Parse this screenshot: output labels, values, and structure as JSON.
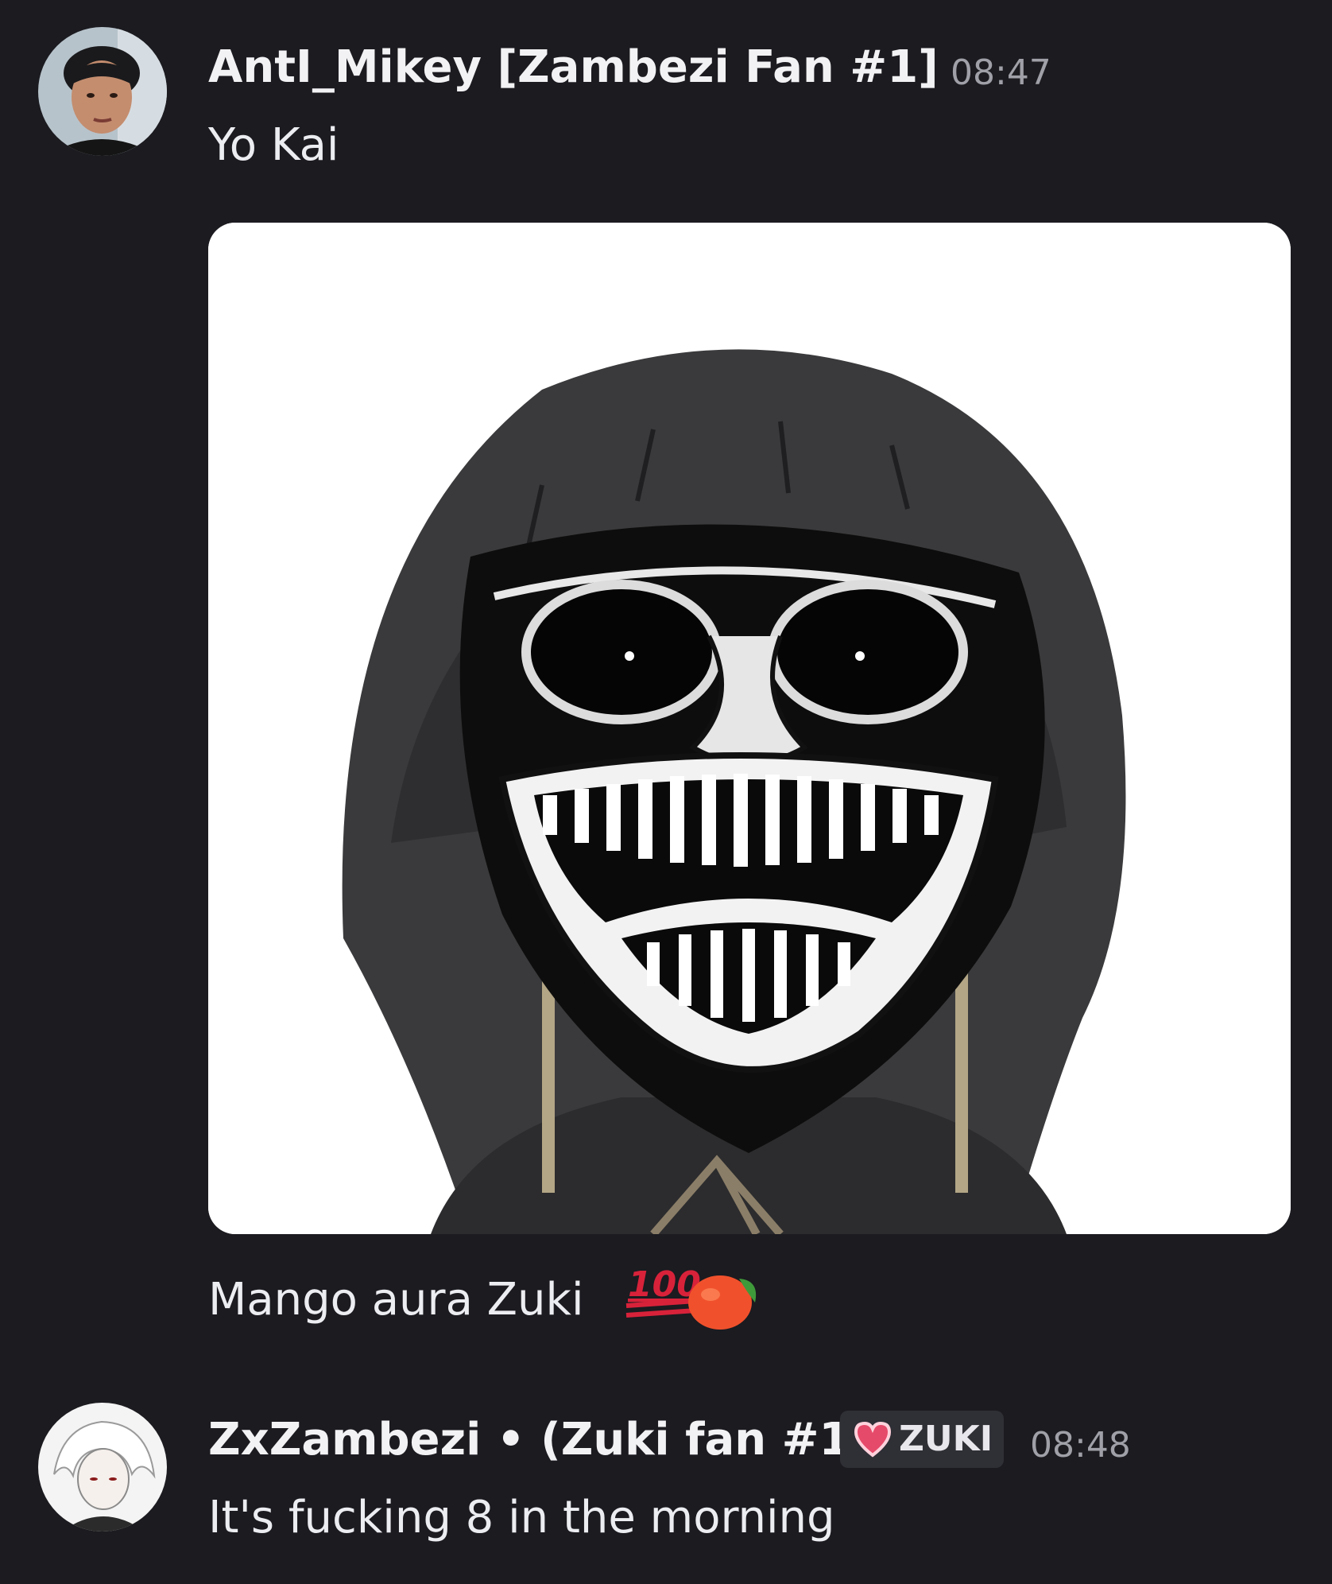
{
  "messages": [
    {
      "username": "AntI_Mikey [Zambezi Fan #1]",
      "timestamp": "08:47",
      "text": "Yo Kai",
      "caption": "Mango aura Zuki",
      "emojis": [
        "hundred-points-emoji",
        "mango-emoji"
      ],
      "emoji_100_text": "100"
    },
    {
      "username": "ZxZambezi • (Zuki fan #1)",
      "tag": "ZUKI",
      "timestamp": "08:48",
      "text": "It's fucking 8 in the morning"
    }
  ],
  "colors": {
    "background": "#1b1b20",
    "username": "#f2f2f4",
    "timestamp": "#a0a0a8",
    "tag_pill": "#2f2f36",
    "heart": "#e64a6a",
    "hundred": "#d8223a",
    "mango": "#f0512c"
  }
}
